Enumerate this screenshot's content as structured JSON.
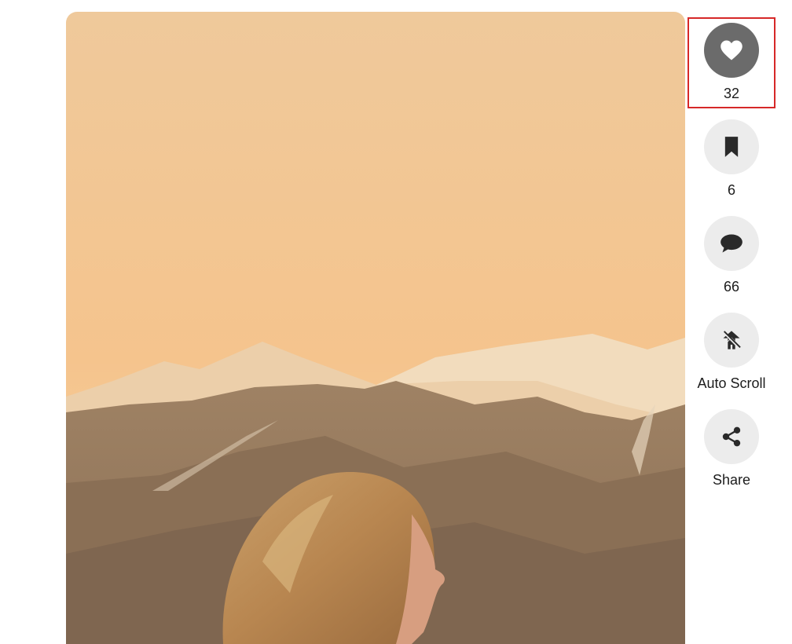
{
  "media": {
    "description_icon": "video-thumbnail"
  },
  "actions": {
    "like": {
      "icon": "heart-icon",
      "count": "32",
      "active": true
    },
    "save": {
      "icon": "bookmark-icon",
      "count": "6"
    },
    "comment": {
      "icon": "comment-icon",
      "count": "66"
    },
    "autoscroll": {
      "icon": "autoscroll-icon",
      "label": "Auto Scroll"
    },
    "share": {
      "icon": "share-icon",
      "label": "Share"
    }
  },
  "colors": {
    "active_button": "#6b6b6b",
    "inactive_button": "#ececec",
    "highlight": "#d62828",
    "icon_active": "#ffffff",
    "icon_inactive": "#2a2a2a"
  }
}
